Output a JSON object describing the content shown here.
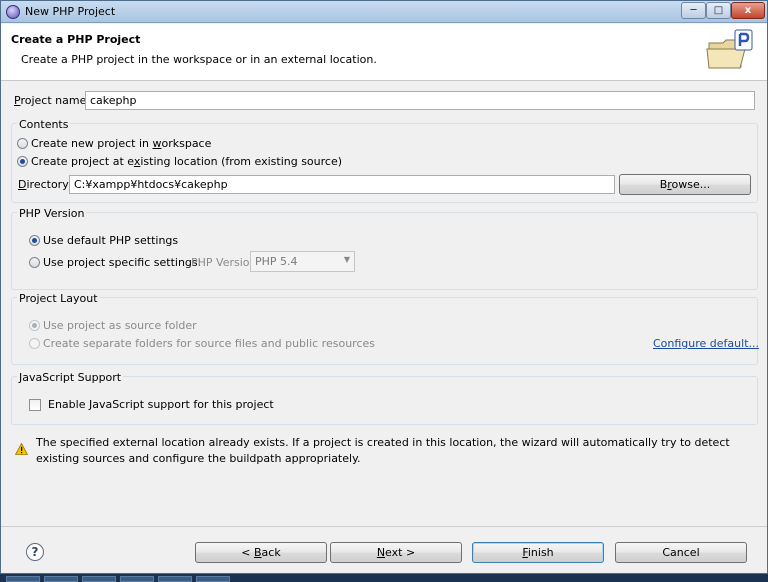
{
  "window": {
    "title": "New PHP Project",
    "minimize": "─",
    "maximize": "□",
    "close": "x"
  },
  "banner": {
    "title": "Create a PHP Project",
    "description": "Create a PHP project in the workspace or in an external location."
  },
  "project_name": {
    "label_prefix": "P",
    "label_rest": "roject name:",
    "value": "cakephp"
  },
  "contents": {
    "title": "Contents",
    "option_new_prefix": "Create new project in ",
    "option_new_ul": "w",
    "option_new_rest": "orkspace",
    "option_existing_prefix": "Create project at e",
    "option_existing_ul": "x",
    "option_existing_rest": "isting location (from existing source)",
    "directory_label_ul": "D",
    "directory_label_rest": "irectory:",
    "directory_value": "C:¥xampp¥htdocs¥cakephp",
    "browse_prefix": "B",
    "browse_ul": "r",
    "browse_rest": "owse..."
  },
  "php_version": {
    "title": "PHP Version",
    "default_label": "Use default PHP settings",
    "specific_label": "Use project specific settings:",
    "version_label": "PHP Version:",
    "version_value": "PHP 5.4"
  },
  "project_layout": {
    "title": "Project Layout",
    "source_folder": "Use project as source folder",
    "separate_folders": "Create separate folders for source files and public resources",
    "configure_link": "Configure default..."
  },
  "javascript": {
    "title": "JavaScript Support",
    "enable_label": "Enable JavaScript support for this project"
  },
  "warning": {
    "text": "The specified external location already exists. If a project is created in this location, the wizard will automatically try to detect existing sources and configure the buildpath appropriately."
  },
  "footer": {
    "help": "?",
    "back_prefix": "< ",
    "back_ul": "B",
    "back_rest": "ack",
    "next_ul": "N",
    "next_rest": "ext >",
    "finish_ul": "F",
    "finish_rest": "inish",
    "cancel": "Cancel"
  },
  "colors": {
    "accent": "#1a4ba0",
    "background": "#f0f0f0",
    "warning": "#e8b400"
  }
}
